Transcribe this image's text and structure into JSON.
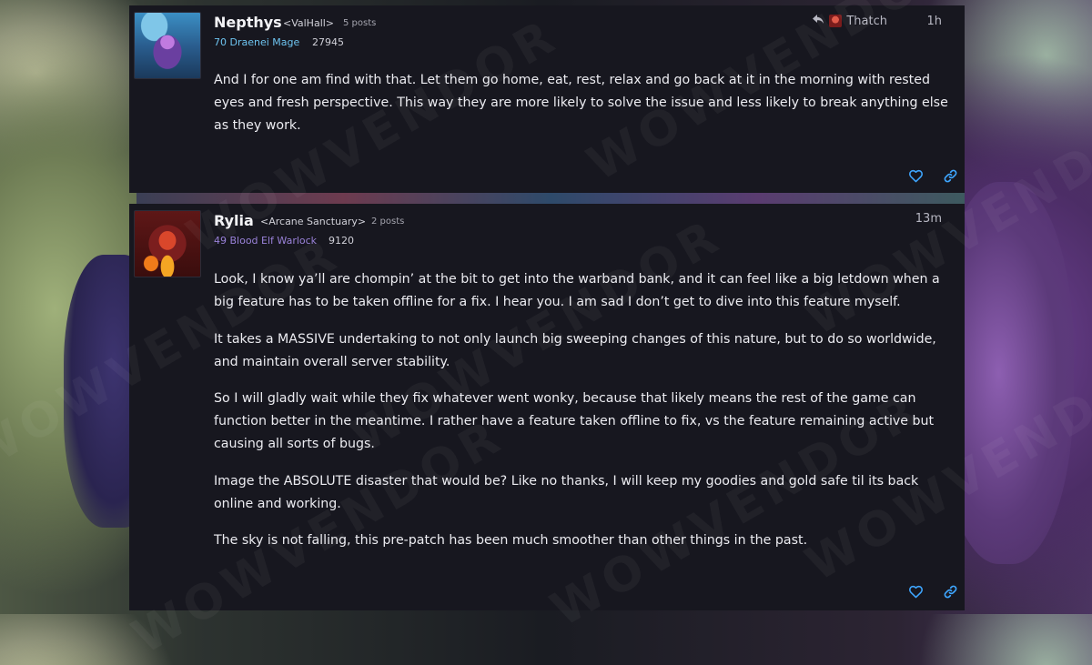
{
  "watermark": "WOWVENDOR",
  "posts": [
    {
      "author": "Nepthys",
      "guild": "<ValHall>",
      "post_count": "5 posts",
      "class_label": "70 Draenei Mage",
      "class_color": "#6ec4f0",
      "achievement_points": "27945",
      "reply_to": "Thatch",
      "time": "1h",
      "paragraphs": [
        "And I for one am find with that. Let them go home, eat, rest, relax and go back at it in the morning with rested eyes and fresh perspective. This way they are more likely to solve the issue and less likely to break anything else as they work."
      ],
      "icons": [
        "reply-arrow-icon",
        "heart-icon",
        "link-icon"
      ]
    },
    {
      "author": "Rylia",
      "guild": "<Arcane Sanctuary>",
      "post_count": "2 posts",
      "class_label": "49 Blood Elf Warlock",
      "class_color": "#9a82d9",
      "achievement_points": "9120",
      "time": "13m",
      "paragraphs": [
        "Look, I know ya’ll are chompin’ at the bit to get into the warband bank, and it can feel like a big letdown when a big feature has to be taken offline for a fix. I hear you. I am sad I don’t get to dive into this feature myself.",
        "It takes a MASSIVE undertaking to not only launch big sweeping changes of this nature, but to do so worldwide, and maintain overall server stability.",
        "So I will gladly wait while they fix whatever went wonky, because that likely means the rest of the game can function better in the meantime. I rather have a feature taken offline to fix, vs the feature remaining active but causing all sorts of bugs.",
        "Image the ABSOLUTE disaster that would be? Like no thanks, I will keep my goodies and gold safe til its back online and working.",
        "The sky is not falling, this pre-patch has been much smoother than other things in the past."
      ],
      "icons": [
        "heart-icon",
        "link-icon"
      ]
    }
  ],
  "colors": {
    "panel": "#17171f",
    "action_blue": "#3ea6ff"
  }
}
